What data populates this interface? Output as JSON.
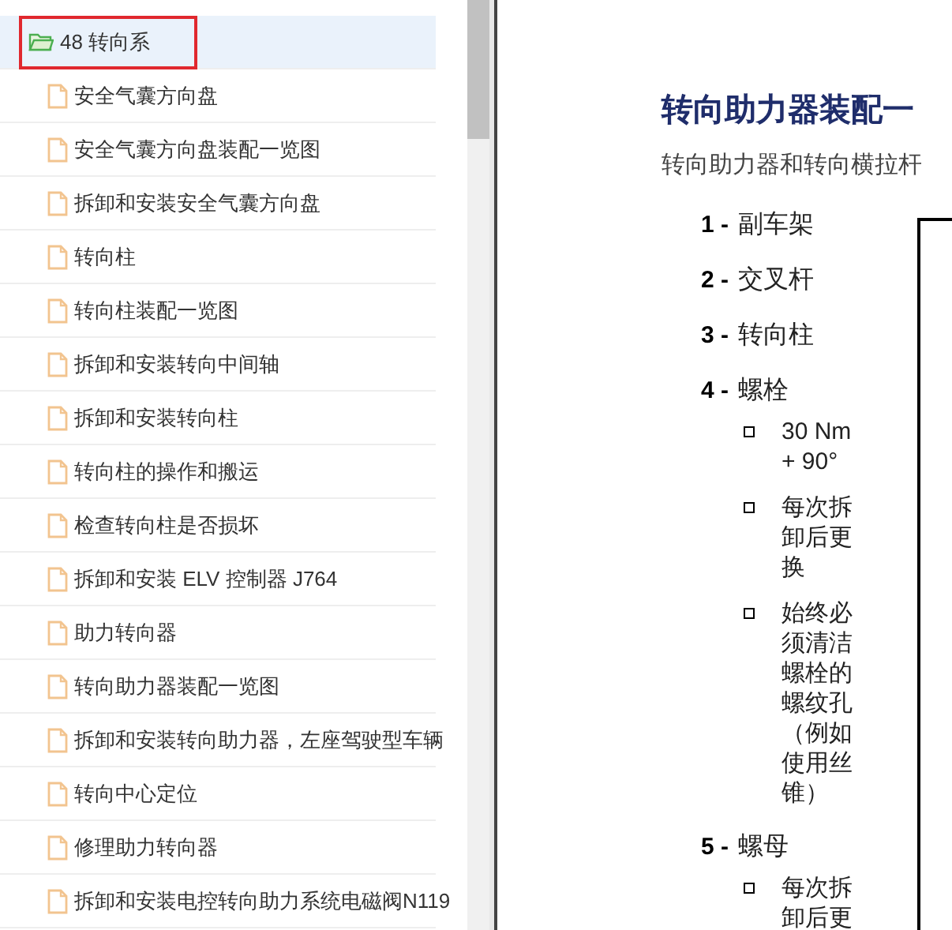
{
  "sidebar": {
    "items": [
      {
        "kind": "folder",
        "label": "48 转向系",
        "selected": true,
        "annotated": true
      },
      {
        "kind": "page",
        "label": "安全气囊方向盘",
        "selected": false,
        "annotated": false
      },
      {
        "kind": "page",
        "label": "安全气囊方向盘装配一览图",
        "selected": false,
        "annotated": false
      },
      {
        "kind": "page",
        "label": "拆卸和安装安全气囊方向盘",
        "selected": false,
        "annotated": false
      },
      {
        "kind": "page",
        "label": "转向柱",
        "selected": false,
        "annotated": false
      },
      {
        "kind": "page",
        "label": "转向柱装配一览图",
        "selected": false,
        "annotated": false
      },
      {
        "kind": "page",
        "label": "拆卸和安装转向中间轴",
        "selected": false,
        "annotated": false
      },
      {
        "kind": "page",
        "label": "拆卸和安装转向柱",
        "selected": false,
        "annotated": false
      },
      {
        "kind": "page",
        "label": "转向柱的操作和搬运",
        "selected": false,
        "annotated": false
      },
      {
        "kind": "page",
        "label": "检查转向柱是否损坏",
        "selected": false,
        "annotated": false
      },
      {
        "kind": "page",
        "label": "拆卸和安装 ELV 控制器 J764",
        "selected": false,
        "annotated": false
      },
      {
        "kind": "page",
        "label": "助力转向器",
        "selected": false,
        "annotated": false
      },
      {
        "kind": "page",
        "label": "转向助力器装配一览图",
        "selected": false,
        "annotated": false
      },
      {
        "kind": "page",
        "label": "拆卸和安装转向助力器，左座驾驶型车辆",
        "selected": false,
        "annotated": false
      },
      {
        "kind": "page",
        "label": "转向中心定位",
        "selected": false,
        "annotated": false
      },
      {
        "kind": "page",
        "label": "修理助力转向器",
        "selected": false,
        "annotated": false
      },
      {
        "kind": "page",
        "label": "拆卸和安装电控转向助力系统电磁阀N119",
        "selected": false,
        "annotated": false
      }
    ]
  },
  "document": {
    "title": "转向助力器装配一",
    "subtitle": "转向助力器和转向横拉杆",
    "legend": [
      {
        "number": "1 -",
        "name": "副车架"
      },
      {
        "number": "2 -",
        "name": "交叉杆"
      },
      {
        "number": "3 -",
        "name": "转向柱"
      },
      {
        "number": "4 -",
        "name": "螺栓",
        "notes": [
          "30 Nm + 90°",
          "每次拆卸后更换",
          "始终必须清洁螺栓的螺纹孔（例如使用丝锥）"
        ]
      },
      {
        "number": "5 -",
        "name": "螺母",
        "notes": [
          "每次拆卸后更"
        ]
      }
    ]
  }
}
